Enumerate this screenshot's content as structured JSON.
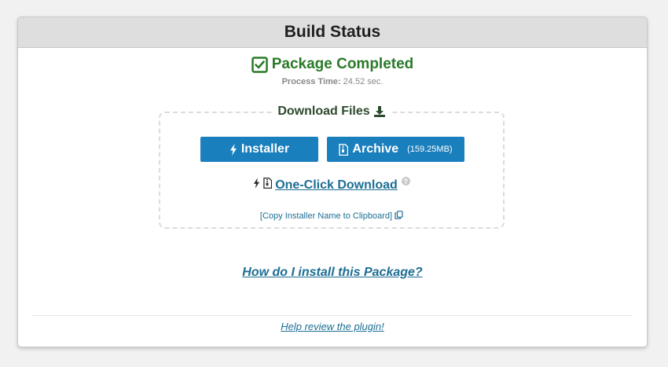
{
  "header": {
    "title": "Build Status"
  },
  "status": {
    "title": "Package Completed",
    "process_time_label": "Process Time:",
    "process_time_value": "24.52 sec."
  },
  "download": {
    "title": "Download Files",
    "installer_label": "Installer",
    "archive_label": "Archive",
    "archive_size": "(159.25MB)",
    "one_click_label": "One-Click Download",
    "copy_label": "[Copy Installer Name to Clipboard]"
  },
  "links": {
    "install_help": "How do I install this Package?",
    "review": "Help review the plugin!"
  },
  "colors": {
    "success": "#2a7a2a",
    "primary_button": "#1a7fbd",
    "link": "#1c6e94",
    "header_bg": "#dedede"
  },
  "icons": {
    "status": "checkbox-checked-icon",
    "download": "download-icon",
    "installer": "bolt-icon",
    "archive": "file-archive-icon",
    "help": "question-circle-icon",
    "copy": "copy-icon"
  }
}
